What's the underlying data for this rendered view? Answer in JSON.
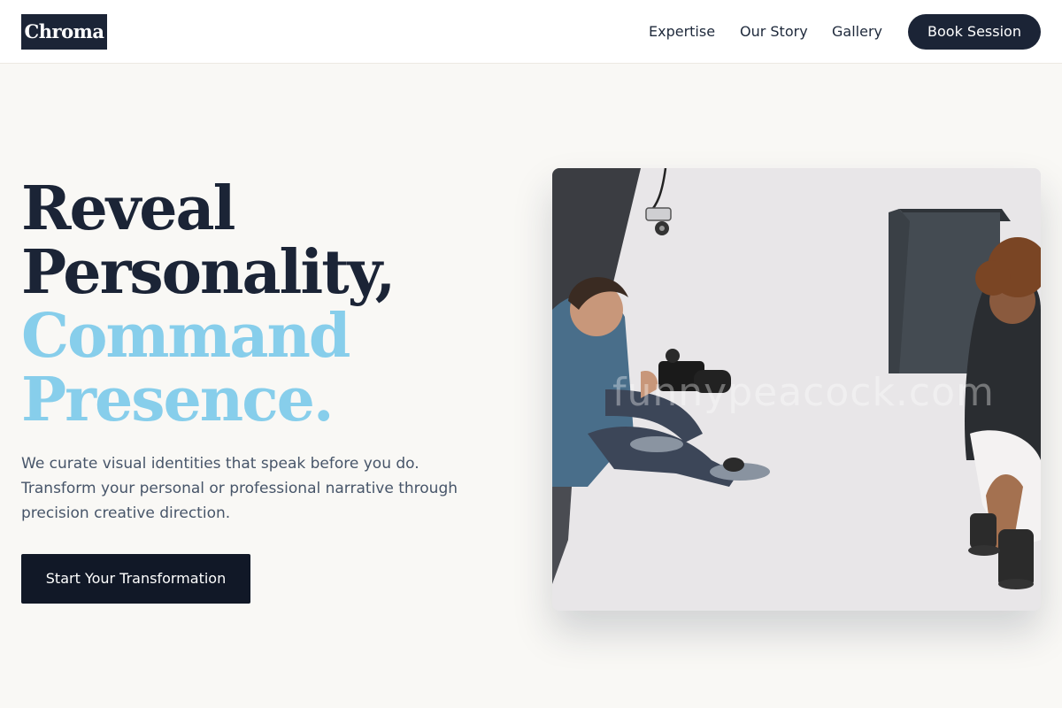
{
  "header": {
    "logo": "Chroma",
    "nav": {
      "expertise": "Expertise",
      "our_story": "Our Story",
      "gallery": "Gallery"
    },
    "book_button": "Book Session"
  },
  "hero": {
    "headline_line1": "Reveal",
    "headline_line2": "Personality,",
    "headline_line3": "Command",
    "headline_line4": "Presence.",
    "subtext": "We curate visual identities that speak before you do. Transform your personal or professional narrative through precision creative direction.",
    "cta_label": "Start Your Transformation",
    "image_watermark": "funnypeacock.com"
  },
  "colors": {
    "primary": "#1b2436",
    "accent": "#87ceeb",
    "background": "#f9f8f5"
  }
}
